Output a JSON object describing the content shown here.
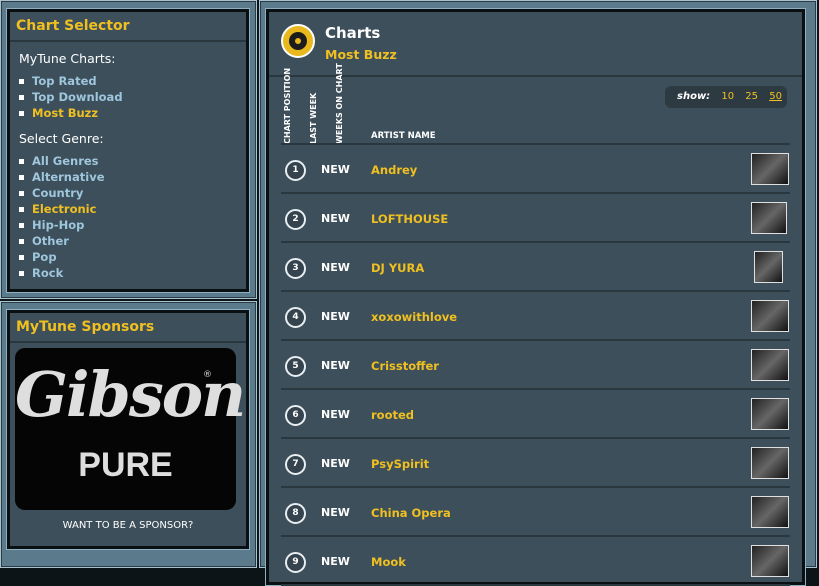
{
  "sidebar": {
    "selector": {
      "title": "Chart Selector",
      "charts_heading": "MyTune Charts:",
      "charts": [
        {
          "label": "Top Rated",
          "active": false
        },
        {
          "label": "Top Download",
          "active": false
        },
        {
          "label": "Most Buzz",
          "active": true
        }
      ],
      "genre_heading": "Select Genre:",
      "genres": [
        {
          "label": "All Genres",
          "active": false
        },
        {
          "label": "Alternative",
          "active": false
        },
        {
          "label": "Country",
          "active": false
        },
        {
          "label": "Electronic",
          "active": true
        },
        {
          "label": "Hip-Hop",
          "active": false
        },
        {
          "label": "Other",
          "active": false
        },
        {
          "label": "Pop",
          "active": false
        },
        {
          "label": "Rock",
          "active": false
        }
      ]
    },
    "sponsors": {
      "title": "MyTune Sponsors",
      "logo_text": "Gibson",
      "logo_sub": "PURE",
      "logo_mark": "®",
      "cta": "WANT TO BE A SPONSOR?"
    }
  },
  "main": {
    "title": "Charts",
    "subtitle": "Most Buzz",
    "show": {
      "label": "show:",
      "options": [
        "10",
        "25",
        "50"
      ],
      "selected": "50"
    },
    "columns": {
      "position": "CHART POSITION",
      "last_week": "LAST WEEK",
      "weeks": "WEEKS ON CHART",
      "artist": "ARTIST NAME"
    },
    "rows": [
      {
        "pos": "1",
        "last": "NEW",
        "artist": "Andrey"
      },
      {
        "pos": "2",
        "last": "NEW",
        "artist": "LOFTHOUSE"
      },
      {
        "pos": "3",
        "last": "NEW",
        "artist": "DJ YURA"
      },
      {
        "pos": "4",
        "last": "NEW",
        "artist": "xoxowithlove"
      },
      {
        "pos": "5",
        "last": "NEW",
        "artist": "Crisstoffer"
      },
      {
        "pos": "6",
        "last": "NEW",
        "artist": "rooted"
      },
      {
        "pos": "7",
        "last": "NEW",
        "artist": "PsySpirit"
      },
      {
        "pos": "8",
        "last": "NEW",
        "artist": "China Opera"
      },
      {
        "pos": "9",
        "last": "NEW",
        "artist": "Mook"
      }
    ]
  },
  "colors": {
    "accent": "#f0c020",
    "link": "#9ec6dc",
    "panel": "#3d4f5a"
  }
}
